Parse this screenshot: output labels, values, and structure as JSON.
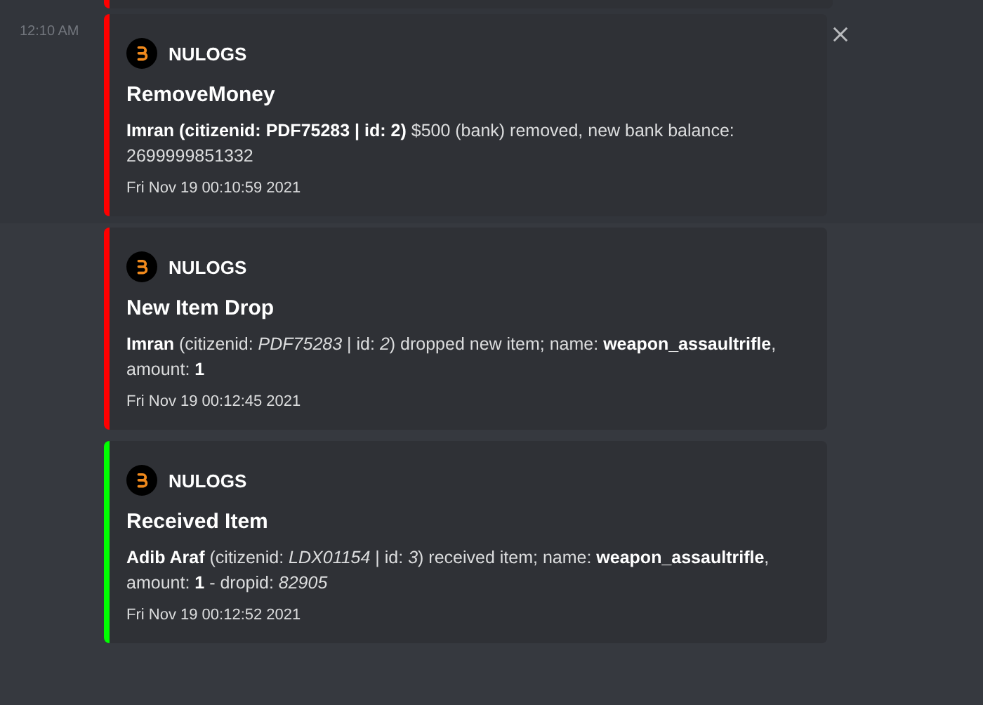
{
  "previous_embed": {
    "color": "#ff0000"
  },
  "messages": [
    {
      "time": "12:10 AM",
      "hovered": true,
      "embed": {
        "color": "#ff0000",
        "author": "NULOGS",
        "title": "RemoveMoney",
        "description": "**Imran (citizenid: PDF75283 | id: 2)** $500 (bank) removed, new bank balance: 2699999851332",
        "footer": "Fri Nov 19 00:10:59 2021"
      }
    },
    {
      "hovered": false,
      "embed": {
        "color": "#ff0000",
        "author": "NULOGS",
        "title": "New Item Drop",
        "description": "**Imran** (citizenid: *PDF75283* | id: *2*) dropped new item; name: **weapon_assaultrifle**, amount: **1**",
        "footer": "Fri Nov 19 00:12:45 2021"
      }
    },
    {
      "hovered": false,
      "embed": {
        "color": "#00ff00",
        "author": "NULOGS",
        "title": "Received Item",
        "description": "**Adib Araf** (citizenid: *LDX01154* | id: *3*) received item; name: **weapon_assaultrifle**, amount: **1** - dropid: *82905*",
        "footer": "Fri Nov 19 00:12:52 2021"
      }
    }
  ]
}
